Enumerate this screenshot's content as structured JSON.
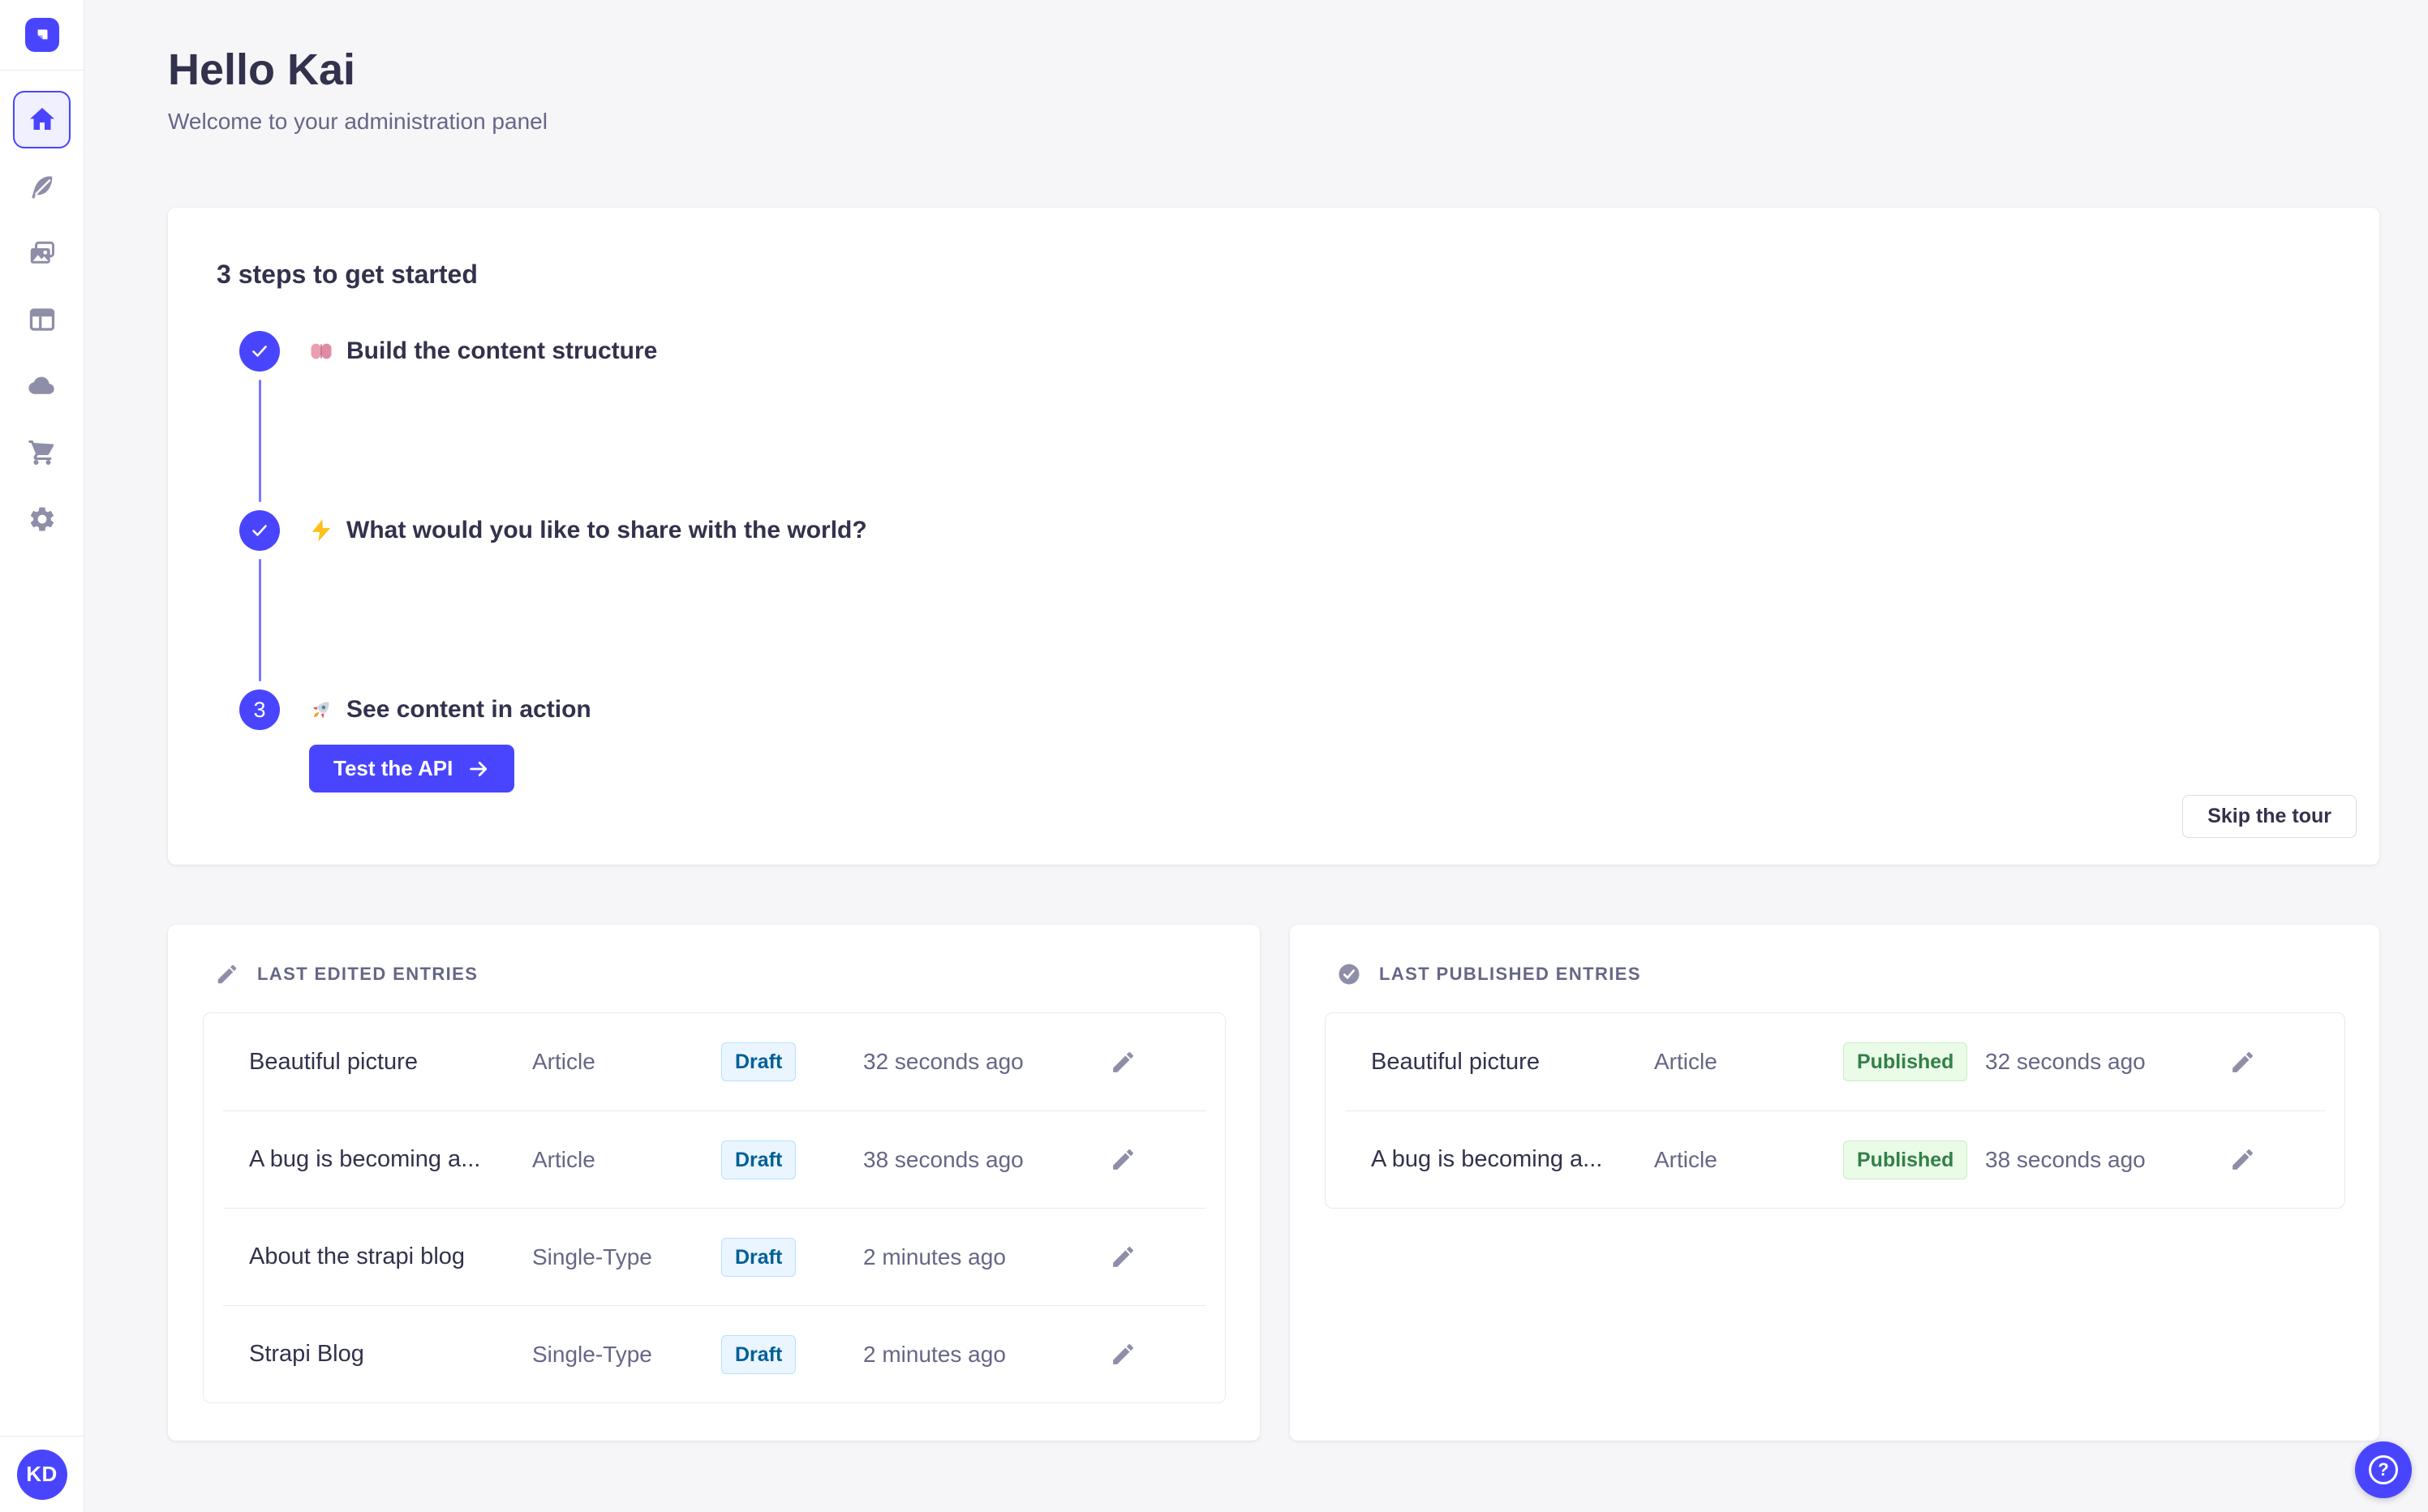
{
  "colors": {
    "accent": "#4945ff",
    "accent_light": "#7b79ff",
    "accent_bg": "#f0f0ff",
    "bg": "#f6f6f9",
    "surface": "#ffffff",
    "border": "#eaeaef",
    "button_border": "#dcdce4",
    "text": "#32324d",
    "text_muted": "#666687",
    "icon_muted": "#8e8ea9",
    "draft_bg": "#eaf5ff",
    "draft_border": "#b8e1ff",
    "draft_text": "#006096",
    "published_bg": "#eafbe7",
    "published_border": "#c6f0c2",
    "published_text": "#328048"
  },
  "sidebar": {
    "logo_icon": "strapi-logo",
    "nav_icons": [
      "home-icon",
      "quill-icon",
      "images-icon",
      "layout-icon",
      "cloud-icon",
      "cart-icon",
      "gear-icon"
    ],
    "active_item": "home",
    "avatar_initials": "KD"
  },
  "header": {
    "title": "Hello Kai",
    "subtitle": "Welcome to your administration panel"
  },
  "onboarding": {
    "title": "3 steps to get started",
    "steps": [
      {
        "status": "done",
        "emoji": "🧠",
        "emoji_icon": "brain-emoji",
        "label": "Build the content structure"
      },
      {
        "status": "done",
        "emoji": "⚡",
        "emoji_icon": "lightning-emoji",
        "label": "What would you like to share with the world?"
      },
      {
        "status": "current",
        "number": "3",
        "emoji": "🚀",
        "emoji_icon": "rocket-emoji",
        "label": "See content in action"
      }
    ],
    "cta_label": "Test the API",
    "skip_label": "Skip the tour"
  },
  "last_edited": {
    "title": "LAST EDITED ENTRIES",
    "header_icon": "pencil-icon",
    "rows": [
      {
        "title": "Beautiful picture",
        "type": "Article",
        "status": "Draft",
        "time": "32 seconds ago"
      },
      {
        "title": "A bug is becoming a...",
        "type": "Article",
        "status": "Draft",
        "time": "38 seconds ago"
      },
      {
        "title": "About the strapi blog",
        "type": "Single-Type",
        "status": "Draft",
        "time": "2 minutes ago"
      },
      {
        "title": "Strapi Blog",
        "type": "Single-Type",
        "status": "Draft",
        "time": "2 minutes ago"
      }
    ]
  },
  "last_published": {
    "title": "LAST PUBLISHED ENTRIES",
    "header_icon": "check-circle-icon",
    "rows": [
      {
        "title": "Beautiful picture",
        "type": "Article",
        "status": "Published",
        "time": "32 seconds ago"
      },
      {
        "title": "A bug is becoming a...",
        "type": "Article",
        "status": "Published",
        "time": "38 seconds ago"
      }
    ]
  },
  "help": {
    "icon_glyph": "?"
  }
}
